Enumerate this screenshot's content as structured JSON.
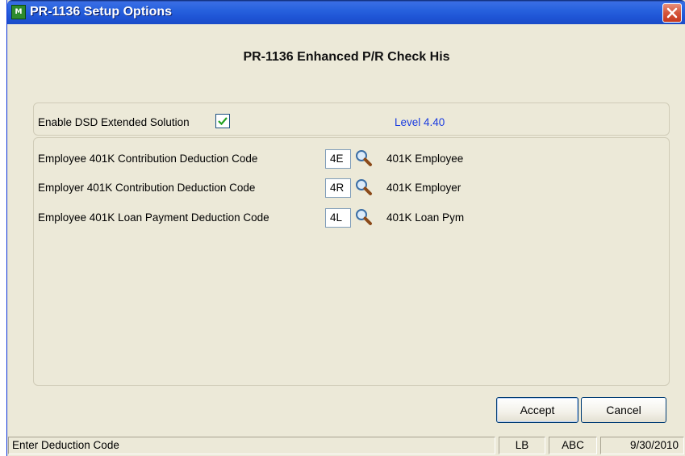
{
  "window": {
    "title": "PR-1136 Setup Options",
    "icon": "app-icon",
    "close_icon": "close-icon"
  },
  "heading": "PR-1136 Enhanced P/R Check His",
  "enable": {
    "label": "Enable DSD Extended Solution",
    "checked": true,
    "level": "Level  4.40"
  },
  "deductions": [
    {
      "label": "Employee 401K Contribution Deduction Code",
      "code": "4E",
      "description": "401K Employee"
    },
    {
      "label": "Employer 401K Contribution Deduction Code",
      "code": "4R",
      "description": "401K Employer"
    },
    {
      "label": "Employee 401K Loan Payment Deduction Code",
      "code": "4L",
      "description": "401K Loan Pym"
    }
  ],
  "buttons": {
    "accept": "Accept",
    "cancel": "Cancel"
  },
  "status": {
    "message": "Enter Deduction Code",
    "user": "LB",
    "company": "ABC",
    "date": "9/30/2010"
  }
}
